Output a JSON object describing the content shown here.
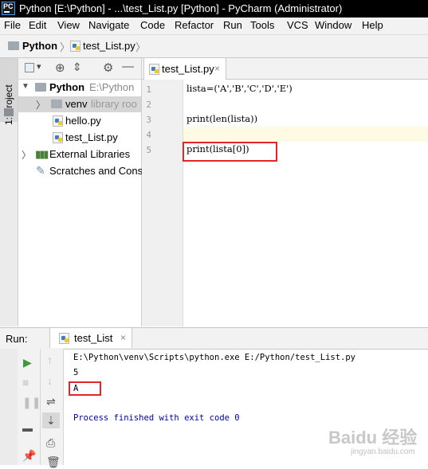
{
  "window": {
    "title": "Python [E:\\Python] - ...\\test_List.py [Python] - PyCharm (Administrator)",
    "app_icon_text": "PC"
  },
  "menu": [
    "File",
    "Edit",
    "View",
    "Navigate",
    "Code",
    "Refactor",
    "Run",
    "Tools",
    "VCS",
    "Window",
    "Help"
  ],
  "breadcrumb": {
    "project": "Python",
    "file": "test_List.py"
  },
  "side_tab": "1: Project",
  "project_tree": {
    "root_name": "Python",
    "root_path": "E:\\Python",
    "venv": "venv",
    "venv_note": "library roo",
    "files": [
      "hello.py",
      "test_List.py"
    ],
    "external_libraries": "External Libraries",
    "scratches": "Scratches and Cons"
  },
  "editor": {
    "tab_label": "test_List.py",
    "line_numbers": [
      "1",
      "2",
      "3",
      "4",
      "5"
    ],
    "lines": [
      "lista=('A','B','C','D','E')",
      "",
      "print(len(lista))",
      "",
      "print(lista[0])"
    ]
  },
  "run": {
    "label": "Run:",
    "tab_label": "test_List",
    "output": [
      "E:\\Python\\venv\\Scripts\\python.exe E:/Python/test_List.py",
      "5",
      "A",
      "",
      "Process finished with exit code 0"
    ]
  },
  "watermark": {
    "brand": "Baidu 经验",
    "url": "jingyan.baidu.com"
  },
  "colors": {
    "highlight_box": "#e0262b",
    "current_line": "#fffae3",
    "console_blue": "#0000aa"
  }
}
